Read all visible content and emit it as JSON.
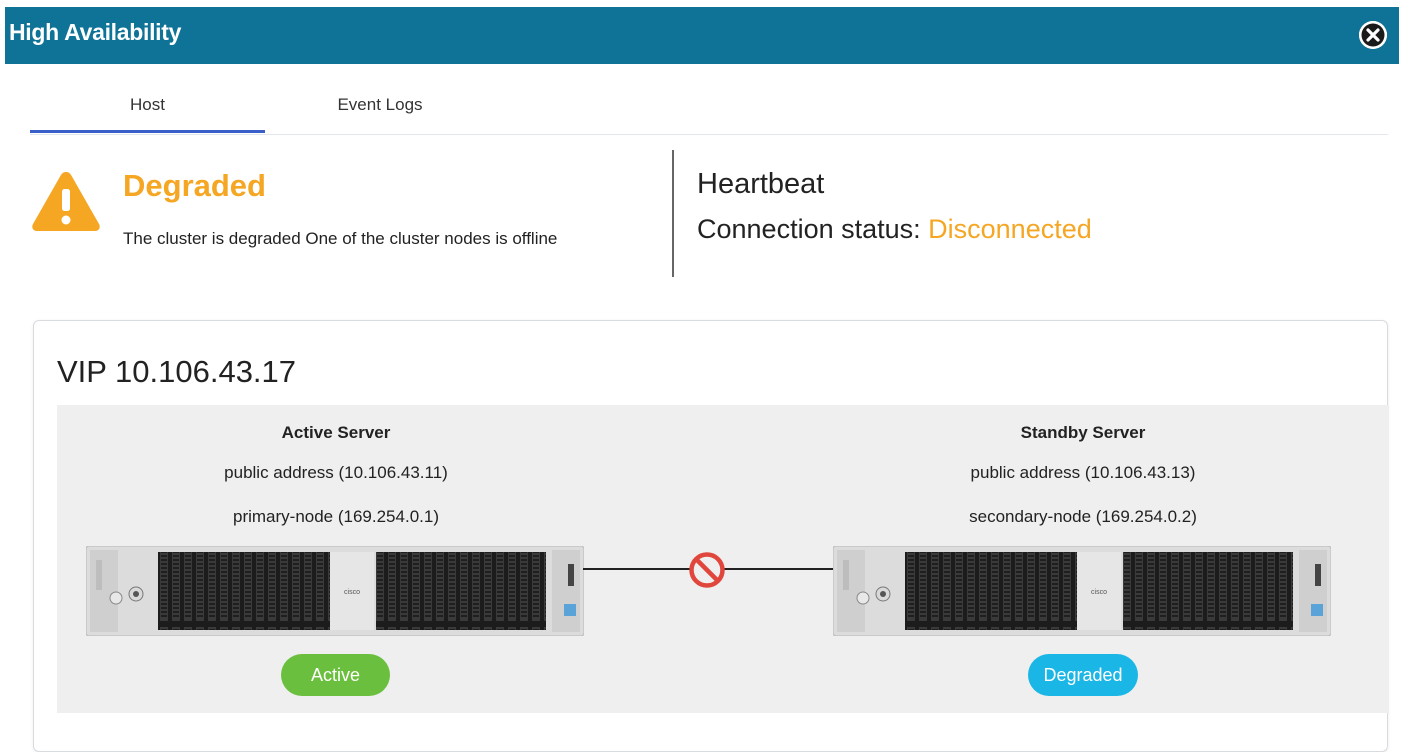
{
  "window": {
    "title": "High Availability"
  },
  "tabs": [
    {
      "label": "Host",
      "selected": true
    },
    {
      "label": "Event Logs",
      "selected": false
    }
  ],
  "status": {
    "title": "Degraded",
    "description": "The cluster is degraded One of the cluster nodes is offline",
    "color": "#f5a623"
  },
  "heartbeat": {
    "title": "Heartbeat",
    "connection_label": "Connection status:",
    "connection_value": "Disconnected"
  },
  "vip": {
    "label": "VIP 10.106.43.17"
  },
  "servers": {
    "active": {
      "title": "Active Server",
      "public_address": "public address (10.106.43.11)",
      "node": "primary-node (169.254.0.1)",
      "badge": "Active",
      "badge_color": "#6bbf3e",
      "brand": "cisco"
    },
    "standby": {
      "title": "Standby Server",
      "public_address": "public address (10.106.43.13)",
      "node": "secondary-node (169.254.0.2)",
      "badge": "Degraded",
      "badge_color": "#1ab6e6",
      "brand": "cisco"
    }
  },
  "link": {
    "icon": "no-connection-icon",
    "color": "#e0463c"
  },
  "colors": {
    "header": "#0f7297",
    "tab_underline": "#3b5fc8"
  }
}
